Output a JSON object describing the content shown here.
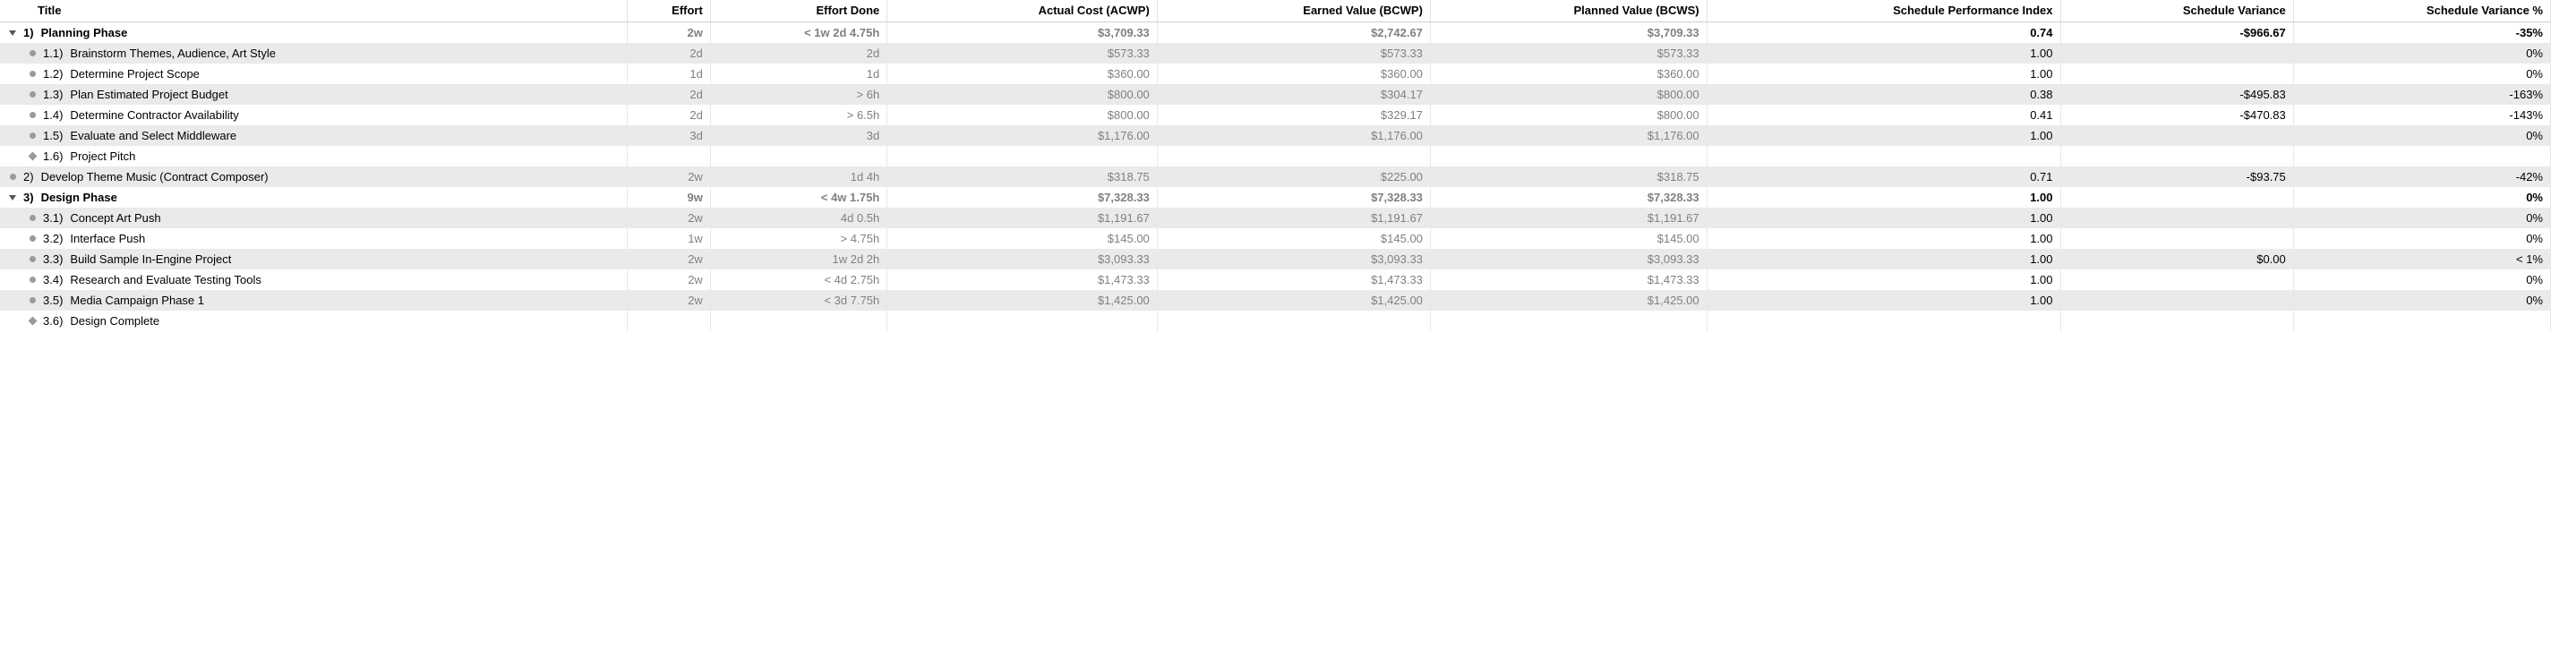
{
  "headers": {
    "title": "Title",
    "effort": "Effort",
    "effort_done": "Effort Done",
    "acwp": "Actual Cost (ACWP)",
    "bcwp": "Earned Value (BCWP)",
    "bcws": "Planned Value (BCWS)",
    "spi": "Schedule Performance Index",
    "sv": "Schedule Variance",
    "svp": "Schedule Variance %"
  },
  "rows": [
    {
      "kind": "group",
      "indent": 0,
      "icon": "tri",
      "wbs": "1)",
      "title": "Planning Phase",
      "effort": "2w",
      "effort_done": "< 1w 2d 4.75h",
      "acwp": "$3,709.33",
      "bcwp": "$2,742.67",
      "bcws": "$3,709.33",
      "spi": "0.74",
      "sv": "-$966.67",
      "svp": "-35%",
      "stripe": "even"
    },
    {
      "kind": "leaf",
      "indent": 1,
      "icon": "dot",
      "wbs": "1.1)",
      "title": "Brainstorm Themes, Audience, Art Style",
      "effort": "2d",
      "effort_done": "2d",
      "acwp": "$573.33",
      "bcwp": "$573.33",
      "bcws": "$573.33",
      "spi": "1.00",
      "sv": "",
      "svp": "0%",
      "stripe": "odd"
    },
    {
      "kind": "leaf",
      "indent": 1,
      "icon": "dot",
      "wbs": "1.2)",
      "title": "Determine Project Scope",
      "effort": "1d",
      "effort_done": "1d",
      "acwp": "$360.00",
      "bcwp": "$360.00",
      "bcws": "$360.00",
      "spi": "1.00",
      "sv": "",
      "svp": "0%",
      "stripe": "even"
    },
    {
      "kind": "leaf",
      "indent": 1,
      "icon": "dot",
      "wbs": "1.3)",
      "title": "Plan Estimated Project Budget",
      "effort": "2d",
      "effort_done": "> 6h",
      "acwp": "$800.00",
      "bcwp": "$304.17",
      "bcws": "$800.00",
      "spi": "0.38",
      "sv": "-$495.83",
      "svp": "-163%",
      "stripe": "odd"
    },
    {
      "kind": "leaf",
      "indent": 1,
      "icon": "dot",
      "wbs": "1.4)",
      "title": "Determine Contractor Availability",
      "effort": "2d",
      "effort_done": "> 6.5h",
      "acwp": "$800.00",
      "bcwp": "$329.17",
      "bcws": "$800.00",
      "spi": "0.41",
      "sv": "-$470.83",
      "svp": "-143%",
      "stripe": "even"
    },
    {
      "kind": "leaf",
      "indent": 1,
      "icon": "dot",
      "wbs": "1.5)",
      "title": "Evaluate and Select Middleware",
      "effort": "3d",
      "effort_done": "3d",
      "acwp": "$1,176.00",
      "bcwp": "$1,176.00",
      "bcws": "$1,176.00",
      "spi": "1.00",
      "sv": "",
      "svp": "0%",
      "stripe": "odd"
    },
    {
      "kind": "leaf",
      "indent": 1,
      "icon": "diamond",
      "wbs": "1.6)",
      "title": "Project Pitch",
      "effort": "",
      "effort_done": "",
      "acwp": "",
      "bcwp": "",
      "bcws": "",
      "spi": "",
      "sv": "",
      "svp": "",
      "stripe": "even"
    },
    {
      "kind": "leaf",
      "indent": 0,
      "icon": "dot",
      "wbs": "2)",
      "title": "Develop Theme Music (Contract Composer)",
      "effort": "2w",
      "effort_done": "1d 4h",
      "acwp": "$318.75",
      "bcwp": "$225.00",
      "bcws": "$318.75",
      "spi": "0.71",
      "sv": "-$93.75",
      "svp": "-42%",
      "stripe": "odd"
    },
    {
      "kind": "group",
      "indent": 0,
      "icon": "tri",
      "wbs": "3)",
      "title": "Design Phase",
      "effort": "9w",
      "effort_done": "< 4w 1.75h",
      "acwp": "$7,328.33",
      "bcwp": "$7,328.33",
      "bcws": "$7,328.33",
      "spi": "1.00",
      "sv": "",
      "svp": "0%",
      "stripe": "even"
    },
    {
      "kind": "leaf",
      "indent": 1,
      "icon": "dot",
      "wbs": "3.1)",
      "title": "Concept Art Push",
      "effort": "2w",
      "effort_done": "4d 0.5h",
      "acwp": "$1,191.67",
      "bcwp": "$1,191.67",
      "bcws": "$1,191.67",
      "spi": "1.00",
      "sv": "",
      "svp": "0%",
      "stripe": "odd"
    },
    {
      "kind": "leaf",
      "indent": 1,
      "icon": "dot",
      "wbs": "3.2)",
      "title": "Interface Push",
      "effort": "1w",
      "effort_done": "> 4.75h",
      "acwp": "$145.00",
      "bcwp": "$145.00",
      "bcws": "$145.00",
      "spi": "1.00",
      "sv": "",
      "svp": "0%",
      "stripe": "even"
    },
    {
      "kind": "leaf",
      "indent": 1,
      "icon": "dot",
      "wbs": "3.3)",
      "title": "Build Sample In-Engine Project",
      "effort": "2w",
      "effort_done": "1w 2d 2h",
      "acwp": "$3,093.33",
      "bcwp": "$3,093.33",
      "bcws": "$3,093.33",
      "spi": "1.00",
      "sv": "$0.00",
      "svp": "< 1%",
      "stripe": "odd"
    },
    {
      "kind": "leaf",
      "indent": 1,
      "icon": "dot",
      "wbs": "3.4)",
      "title": "Research and Evaluate Testing Tools",
      "effort": "2w",
      "effort_done": "< 4d 2.75h",
      "acwp": "$1,473.33",
      "bcwp": "$1,473.33",
      "bcws": "$1,473.33",
      "spi": "1.00",
      "sv": "",
      "svp": "0%",
      "stripe": "even"
    },
    {
      "kind": "leaf",
      "indent": 1,
      "icon": "dot",
      "wbs": "3.5)",
      "title": "Media Campaign Phase 1",
      "effort": "2w",
      "effort_done": "< 3d 7.75h",
      "acwp": "$1,425.00",
      "bcwp": "$1,425.00",
      "bcws": "$1,425.00",
      "spi": "1.00",
      "sv": "",
      "svp": "0%",
      "stripe": "odd"
    },
    {
      "kind": "leaf",
      "indent": 1,
      "icon": "diamond",
      "wbs": "3.6)",
      "title": "Design Complete",
      "effort": "",
      "effort_done": "",
      "acwp": "",
      "bcwp": "",
      "bcws": "",
      "spi": "",
      "sv": "",
      "svp": "",
      "stripe": "even"
    }
  ]
}
